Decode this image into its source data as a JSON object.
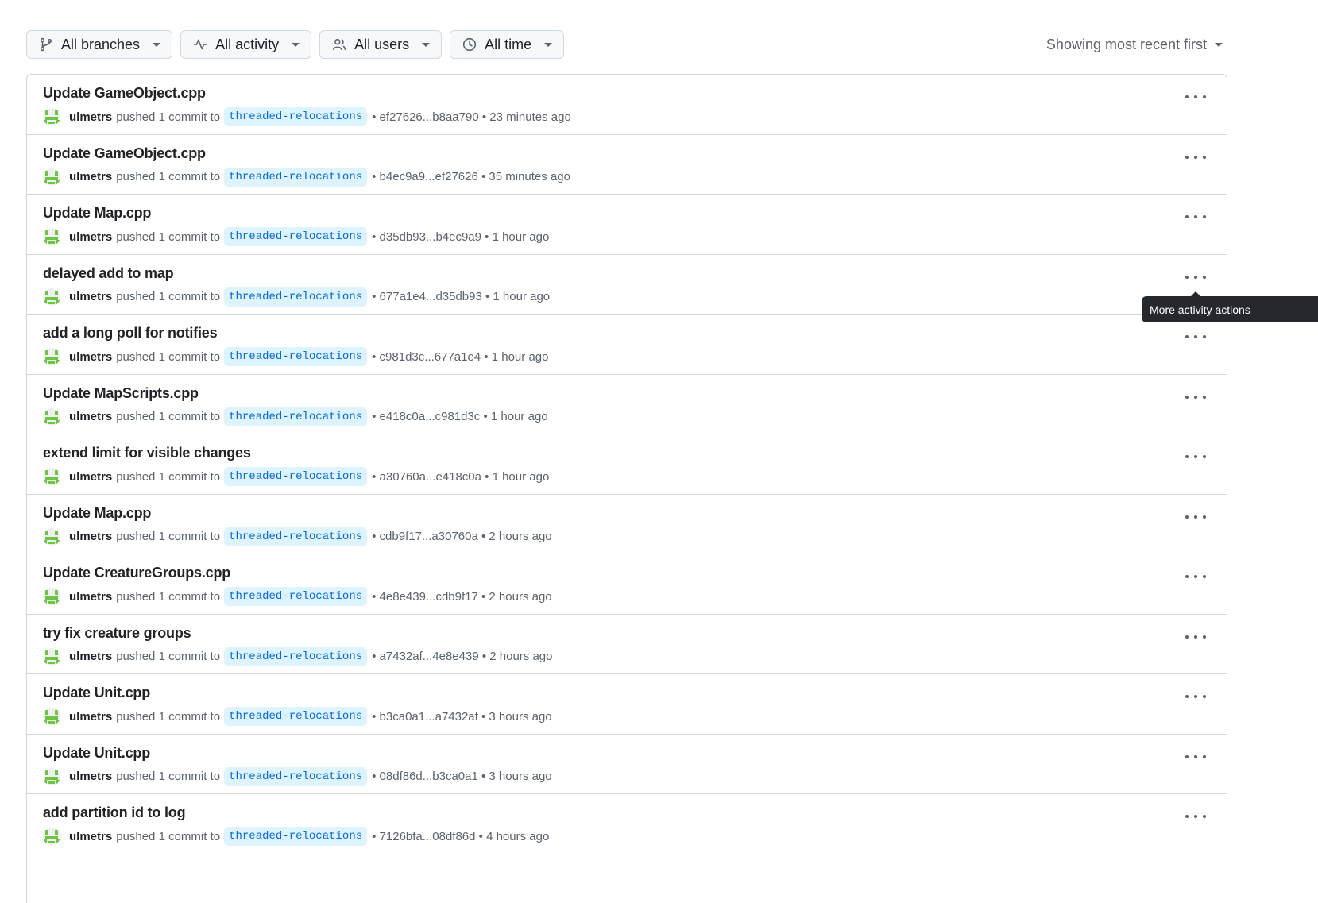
{
  "filters": {
    "branches": {
      "label": "All branches",
      "icon": "git-branch-icon"
    },
    "activity": {
      "label": "All activity",
      "icon": "pulse-icon"
    },
    "users": {
      "label": "All users",
      "icon": "people-icon"
    },
    "time": {
      "label": "All time",
      "icon": "clock-icon"
    },
    "sort": {
      "label": "Showing most recent first"
    }
  },
  "activities": [
    {
      "title": "Update GameObject.cpp",
      "user": "ulmetrs",
      "action": "pushed 1 commit to",
      "branch": "threaded-relocations",
      "range": "• ef27626...b8aa790 • 23 minutes ago"
    },
    {
      "title": "Update GameObject.cpp",
      "user": "ulmetrs",
      "action": "pushed 1 commit to",
      "branch": "threaded-relocations",
      "range": "• b4ec9a9...ef27626 • 35 minutes ago"
    },
    {
      "title": "Update Map.cpp",
      "user": "ulmetrs",
      "action": "pushed 1 commit to",
      "branch": "threaded-relocations",
      "range": "• d35db93...b4ec9a9 • 1 hour ago"
    },
    {
      "title": "delayed add to map",
      "user": "ulmetrs",
      "action": "pushed 1 commit to",
      "branch": "threaded-relocations",
      "range": "• 677a1e4...d35db93 • 1 hour ago"
    },
    {
      "title": "add a long poll for notifies",
      "user": "ulmetrs",
      "action": "pushed 1 commit to",
      "branch": "threaded-relocations",
      "range": "• c981d3c...677a1e4 • 1 hour ago"
    },
    {
      "title": "Update MapScripts.cpp",
      "user": "ulmetrs",
      "action": "pushed 1 commit to",
      "branch": "threaded-relocations",
      "range": "• e418c0a...c981d3c • 1 hour ago"
    },
    {
      "title": "extend limit for visible changes",
      "user": "ulmetrs",
      "action": "pushed 1 commit to",
      "branch": "threaded-relocations",
      "range": "• a30760a...e418c0a • 1 hour ago"
    },
    {
      "title": "Update Map.cpp",
      "user": "ulmetrs",
      "action": "pushed 1 commit to",
      "branch": "threaded-relocations",
      "range": "• cdb9f17...a30760a • 2 hours ago"
    },
    {
      "title": "Update CreatureGroups.cpp",
      "user": "ulmetrs",
      "action": "pushed 1 commit to",
      "branch": "threaded-relocations",
      "range": "• 4e8e439...cdb9f17 • 2 hours ago"
    },
    {
      "title": "try fix creature groups",
      "user": "ulmetrs",
      "action": "pushed 1 commit to",
      "branch": "threaded-relocations",
      "range": "• a7432af...4e8e439 • 2 hours ago"
    },
    {
      "title": "Update Unit.cpp",
      "user": "ulmetrs",
      "action": "pushed 1 commit to",
      "branch": "threaded-relocations",
      "range": "• b3ca0a1...a7432af • 3 hours ago"
    },
    {
      "title": "Update Unit.cpp",
      "user": "ulmetrs",
      "action": "pushed 1 commit to",
      "branch": "threaded-relocations",
      "range": "• 08df86d...b3ca0a1 • 3 hours ago"
    },
    {
      "title": "add partition id to log",
      "user": "ulmetrs",
      "action": "pushed 1 commit to",
      "branch": "threaded-relocations",
      "range": "• 7126bfa...08df86d • 4 hours ago"
    }
  ],
  "tooltip": {
    "text": "More activity actions"
  },
  "colors": {
    "branch_text": "#0969da",
    "branch_bg": "#ddf4ff",
    "avatar": "#6cc644",
    "tooltip_bg": "#25292e"
  }
}
